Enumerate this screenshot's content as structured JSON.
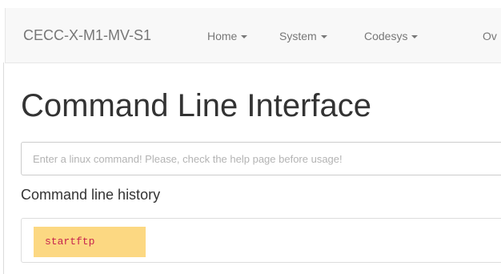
{
  "navbar": {
    "brand": "CECC-X-M1-MV-S1",
    "items": [
      {
        "label": "Home"
      },
      {
        "label": "System"
      },
      {
        "label": "Codesys"
      },
      {
        "label": "Ov"
      }
    ]
  },
  "main": {
    "title": "Command Line Interface",
    "command_input": {
      "value": "",
      "placeholder": "Enter a linux command! Please, check the help page before usage!"
    },
    "history": {
      "label": "Command line history",
      "entries": [
        "startftp"
      ]
    }
  },
  "colors": {
    "navbar_bg": "#f8f8f8",
    "history_highlight": "#fcd882",
    "command_text": "#c7254e"
  }
}
